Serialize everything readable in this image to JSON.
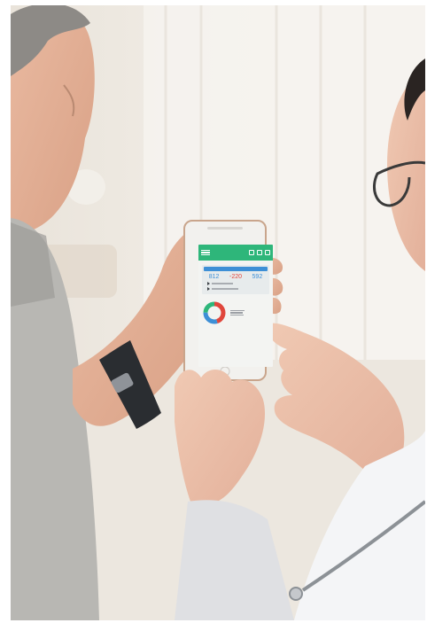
{
  "app": {
    "stats": [
      {
        "value": "812",
        "color": "#3d8fd6"
      },
      {
        "value": "-220",
        "color": "#e0463c"
      },
      {
        "value": "592",
        "color": "#3d8fd6"
      }
    ],
    "donut": {
      "segments": [
        {
          "color": "#e0463c",
          "fraction": 0.45
        },
        {
          "color": "#3d8fd6",
          "fraction": 0.3
        },
        {
          "color": "#2eb67a",
          "fraction": 0.25
        }
      ]
    }
  },
  "colors": {
    "app_green": "#2eb67a",
    "app_blue": "#3d8fd6",
    "app_red": "#e0463c",
    "watch_band": "#2a2d31"
  }
}
